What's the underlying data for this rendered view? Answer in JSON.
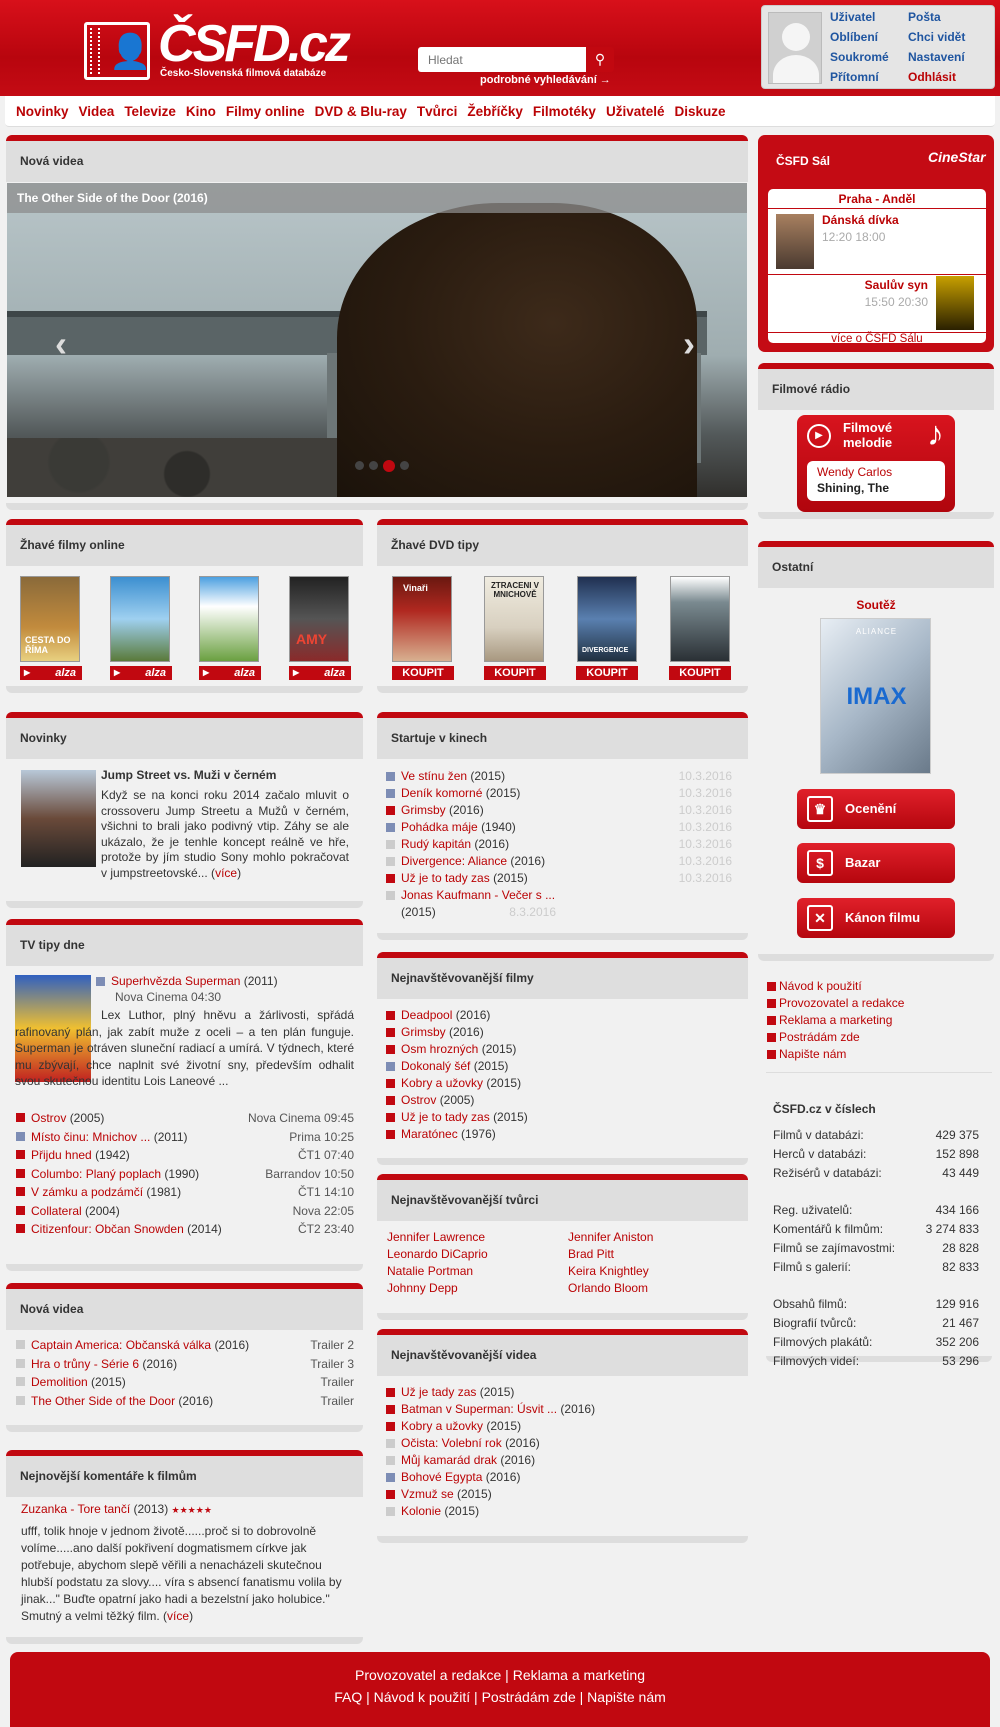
{
  "header": {
    "logo_text": "ČSFD.cz",
    "logo_tagline": "Česko-Slovenská filmová databáze",
    "search_placeholder": "Hledat",
    "advanced_search": "podrobné vyhledávání →"
  },
  "user_links": [
    "Uživatel",
    "Pošta",
    "Oblíbení",
    "Chci vidět",
    "Soukromé",
    "Nastavení",
    "Přítomní",
    "Odhlásit"
  ],
  "nav": [
    "Novinky",
    "Videa",
    "Televize",
    "Kino",
    "Filmy online",
    "DVD & Blu-ray",
    "Tvůrci",
    "Žebříčky",
    "Filmotéky",
    "Uživatelé",
    "Diskuze"
  ],
  "nova_videa_hero": {
    "heading": "Nová videa",
    "title": "The Other Side of the Door (2016)"
  },
  "hot_online": {
    "heading": "Žhavé filmy online",
    "shop": "alza",
    "posters": [
      "CESTA DO ŘÍMA",
      "",
      "",
      "AMY"
    ]
  },
  "hot_dvd": {
    "heading": "Žhavé DVD tipy",
    "button": "KOUPIT",
    "posters": [
      "Vinaři",
      "ZTRACENI V MNICHOVĚ",
      "DIVERGENCE",
      ""
    ]
  },
  "novinky": {
    "heading": "Novinky",
    "title": "Jump Street vs. Muži v černém",
    "text": "Když se na konci roku 2014 začalo mluvit o crossoveru Jump Streetu a Mužů v černém, všichni to brali jako podivný vtip. Záhy se ale ukázalo, že je tenhle koncept reálně ve hře, protože by jím studio Sony mohlo pokračovat v jumpstreetovské...",
    "more": "více"
  },
  "startuje": {
    "heading": "Startuje v kinech",
    "items": [
      {
        "title": "Ve stínu žen",
        "year": "(2015)",
        "date": "10.3.2016",
        "color": "#7d8db5"
      },
      {
        "title": "Deník komorné",
        "year": "(2015)",
        "date": "10.3.2016",
        "color": "#7d8db5"
      },
      {
        "title": "Grimsby",
        "year": "(2016)",
        "date": "10.3.2016",
        "color": "#c10810"
      },
      {
        "title": "Pohádka máje",
        "year": "(1940)",
        "date": "10.3.2016",
        "color": "#7d8db5"
      },
      {
        "title": "Rudý kapitán",
        "year": "(2016)",
        "date": "10.3.2016",
        "color": "#ccc"
      },
      {
        "title": "Divergence: Aliance",
        "year": "(2016)",
        "date": "10.3.2016",
        "color": "#ccc"
      },
      {
        "title": "Už je to tady zas",
        "year": "(2015)",
        "date": "10.3.2016",
        "color": "#c10810"
      },
      {
        "title": "Jonas Kaufmann - Večer s ...",
        "year": "(2015)",
        "date": "8.3.2016",
        "color": "#ccc"
      }
    ]
  },
  "tv": {
    "heading": "TV tipy dne",
    "featured_title": "Superhvězda Superman",
    "featured_year": "(2011)",
    "featured_channel": "Nova Cinema 04:30",
    "featured_text": "Lex Luthor, plný hněvu a žárlivosti, spřádá rafinovaný plán, jak zabít muže z oceli – a ten plán funguje. Superman je otráven sluneční radiací a umírá. V týdnech, které mu zbývají, chce naplnit své životní sny, především odhalit svou skutečnou identitu Lois Laneové ...",
    "items": [
      {
        "title": "Ostrov",
        "year": "(2005)",
        "time": "Nova Cinema 09:45",
        "color": "#c10810"
      },
      {
        "title": "Místo činu: Mnichov ...",
        "year": "(2011)",
        "time": "Prima 10:25",
        "color": "#7d8db5"
      },
      {
        "title": "Přijdu hned",
        "year": "(1942)",
        "time": "ČT1 07:40",
        "color": "#c10810"
      },
      {
        "title": "Columbo: Planý poplach",
        "year": "(1990)",
        "time": "Barrandov 10:50",
        "color": "#c10810"
      },
      {
        "title": "V zámku a podzámčí",
        "year": "(1981)",
        "time": "ČT1 14:10",
        "color": "#c10810"
      },
      {
        "title": "Collateral",
        "year": "(2004)",
        "time": "Nova 22:05",
        "color": "#c10810"
      },
      {
        "title": "Citizenfour: Občan Snowden",
        "year": "(2014)",
        "time": "ČT2 23:40",
        "color": "#c10810"
      }
    ]
  },
  "most_films": {
    "heading": "Nejnavštěvovanější filmy",
    "items": [
      {
        "title": "Deadpool",
        "year": "(2016)",
        "color": "#c10810"
      },
      {
        "title": "Grimsby",
        "year": "(2016)",
        "color": "#c10810"
      },
      {
        "title": "Osm hrozných",
        "year": "(2015)",
        "color": "#c10810"
      },
      {
        "title": "Dokonalý šéf",
        "year": "(2015)",
        "color": "#7d8db5"
      },
      {
        "title": "Kobry a užovky",
        "year": "(2015)",
        "color": "#c10810"
      },
      {
        "title": "Ostrov",
        "year": "(2005)",
        "color": "#c10810"
      },
      {
        "title": "Už je to tady zas",
        "year": "(2015)",
        "color": "#c10810"
      },
      {
        "title": "Maratónec",
        "year": "(1976)",
        "color": "#c10810"
      }
    ]
  },
  "most_creators": {
    "heading": "Nejnavštěvovanější tvůrci",
    "items": [
      "Jennifer Lawrence",
      "Jennifer Aniston",
      "Leonardo DiCaprio",
      "Brad Pitt",
      "Natalie Portman",
      "Keira Knightley",
      "Johnny Depp",
      "Orlando Bloom"
    ]
  },
  "nova_videa_list": {
    "heading": "Nová videa",
    "items": [
      {
        "title": "Captain America: Občanská válka",
        "year": "(2016)",
        "type": "Trailer 2"
      },
      {
        "title": "Hra o trůny - Série 6",
        "year": "(2016)",
        "type": "Trailer 3"
      },
      {
        "title": "Demolition",
        "year": "(2015)",
        "type": "Trailer"
      },
      {
        "title": "The Other Side of the Door",
        "year": "(2016)",
        "type": "Trailer"
      }
    ]
  },
  "most_videos": {
    "heading": "Nejnavštěvovanější videa",
    "items": [
      {
        "title": "Už je tady zas",
        "year": "(2015)",
        "color": "#c10810"
      },
      {
        "title": "Batman v Superman: Úsvit ...",
        "year": "(2016)",
        "color": "#c10810"
      },
      {
        "title": "Kobry a užovky",
        "year": "(2015)",
        "color": "#c10810"
      },
      {
        "title": "Očista: Volební rok",
        "year": "(2016)",
        "color": "#ccc"
      },
      {
        "title": "Můj kamarád drak",
        "year": "(2016)",
        "color": "#ccc"
      },
      {
        "title": "Bohové Egypta",
        "year": "(2016)",
        "color": "#7d8db5"
      },
      {
        "title": "Vzmuž se",
        "year": "(2015)",
        "color": "#c10810"
      },
      {
        "title": "Kolonie",
        "year": "(2015)",
        "color": "#ccc"
      }
    ]
  },
  "comments": {
    "heading": "Nejnovější komentáře k filmům",
    "user_film": "Zuzanka - Tore tančí",
    "year": "(2013)",
    "stars": "★★★★★",
    "text": "ufff, tolik hnoje v jednom životě......proč si to dobrovolně volíme.....ano další pokřivení dogmatismem církve jak potřebuje, abychom slepě věřili a nenacházeli skutečnou hlubší podstatu za slovy.... víra s absencí fanatismu volila by jinak...\" Buďte opatrní jako hadi a bezelstní jako holubice.\" Smutný a velmi těžký film.",
    "more": "více"
  },
  "sal": {
    "heading": "ČSFD Sál",
    "brand": "CineStar",
    "cinema": "Praha - Anděl",
    "film1": "Dánská dívka",
    "times1": "12:20 18:00",
    "film2": "Saulův syn",
    "times2": "15:50 20:30",
    "more": "více o ČSFD Sálu"
  },
  "radio": {
    "heading": "Filmové rádio",
    "station": "Filmové melodie",
    "artist": "Wendy Carlos",
    "track": "Shining, The"
  },
  "ostatni": {
    "heading": "Ostatní",
    "soutez": "Soutěž",
    "banner_text": "IMAX",
    "banner_sub": "ALIANCE",
    "buttons": [
      "Ocenění",
      "Bazar",
      "Kánon filmu"
    ],
    "links": [
      "Návod k použití",
      "Provozovatel a redakce",
      "Reklama a marketing",
      "Postrádám zde",
      "Napište nám"
    ]
  },
  "numbers": {
    "heading": "ČSFD.cz v číslech",
    "groups": [
      [
        [
          "Filmů v databázi:",
          "429 375"
        ],
        [
          "Herců v databázi:",
          "152 898"
        ],
        [
          "Režisérů v databázi:",
          "43 449"
        ]
      ],
      [
        [
          "Reg. uživatelů:",
          "434 166"
        ],
        [
          "Komentářů k filmům:",
          "3 274 833"
        ],
        [
          "Filmů se zajímavostmi:",
          "28 828"
        ],
        [
          "Filmů s galerií:",
          "82 833"
        ]
      ],
      [
        [
          "Obsahů filmů:",
          "129 916"
        ],
        [
          "Biografií tvůrců:",
          "21 467"
        ],
        [
          "Filmových plakátů:",
          "352 206"
        ],
        [
          "Filmových videí:",
          "53 296"
        ]
      ]
    ]
  },
  "footer": {
    "row1": [
      "Provozovatel a redakce",
      "Reklama a marketing"
    ],
    "row2": [
      "FAQ",
      "Návod k použití",
      "Postrádám zde",
      "Napište nám"
    ]
  },
  "colors": {
    "brand": "#c10810"
  }
}
